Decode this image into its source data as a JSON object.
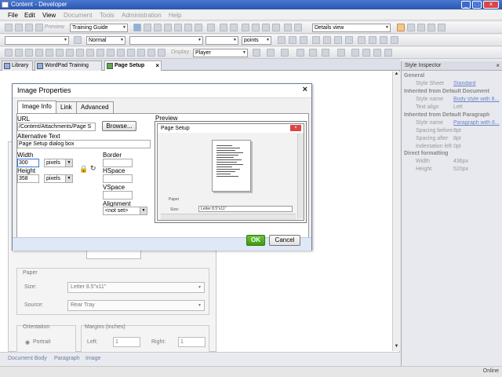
{
  "window": {
    "title": "Content - Developer"
  },
  "menu": {
    "items": [
      "File",
      "Edit",
      "View",
      "Document",
      "Tools",
      "Administration",
      "Help"
    ]
  },
  "toolbar1": {
    "preview_label": "Preview",
    "template_value": "Training Guide",
    "view_value": "Details view"
  },
  "toolbar2": {
    "style_value": "Normal",
    "size_unit": "points"
  },
  "toolbar3": {
    "display_label": "Display:",
    "display_value": "Player"
  },
  "tabs": [
    {
      "label": "Library"
    },
    {
      "label": "WordPad Training"
    },
    {
      "label": "Page Setup"
    }
  ],
  "background": {
    "paper_group": "Paper",
    "size_label": "Size:",
    "size_value": "Letter 8.5\"x11\"",
    "source_label": "Source:",
    "source_value": "Rear Tray",
    "orientation_group": "Orientation",
    "portrait_label": "Portrait",
    "margins_group": "Margins (inches)",
    "left_label": "Left:",
    "left_value": "1",
    "right_label": "Right:",
    "right_value": "1"
  },
  "pathbar": {
    "items": [
      "Document Body",
      "Paragraph",
      "Image"
    ]
  },
  "status": {
    "text": "Online"
  },
  "inspector": {
    "title": "Style Inspector",
    "sections": {
      "general": "General",
      "default_doc": "Inherited from Default Document",
      "default_para": "Inherited from Default Paragraph",
      "direct": "Direct formatting"
    },
    "general_rows": [
      {
        "k": "Style Sheet",
        "v": "Standard"
      }
    ],
    "doc_rows": [
      {
        "k": "Style name",
        "v": "Body style with 8..."
      },
      {
        "k": "Text align",
        "v": "Left"
      }
    ],
    "para_rows": [
      {
        "k": "Style name",
        "v": "Paragraph with 8..."
      },
      {
        "k": "Spacing before",
        "v": "8pt"
      },
      {
        "k": "Spacing after",
        "v": "8pt"
      },
      {
        "k": "Indentation left",
        "v": "0pt"
      }
    ],
    "direct_rows": [
      {
        "k": "Width",
        "v": "436px"
      },
      {
        "k": "Height",
        "v": "520px"
      }
    ]
  },
  "dialog": {
    "title": "Image Properties",
    "tabs": [
      "Image Info",
      "Link",
      "Advanced"
    ],
    "url_label": "URL",
    "url_value": "/Content/Attachments/Page S",
    "browse_label": "Browse...",
    "alt_label": "Alternative Text",
    "alt_value": "Page Setup dialog box",
    "width_label": "Width",
    "width_value": "300",
    "width_unit": "pixels",
    "height_label": "Height",
    "height_value": "358",
    "height_unit": "pixels",
    "border_label": "Border",
    "hspace_label": "HSpace",
    "vspace_label": "VSpace",
    "align_label": "Alignment",
    "align_value": "<not set>",
    "preview_label": "Preview",
    "preview_title": "Page Setup",
    "preview_paper": "Paper",
    "preview_size_label": "Size:",
    "preview_size_value": "Letter 8.5\"x11\"",
    "ok_label": "OK",
    "cancel_label": "Cancel"
  }
}
